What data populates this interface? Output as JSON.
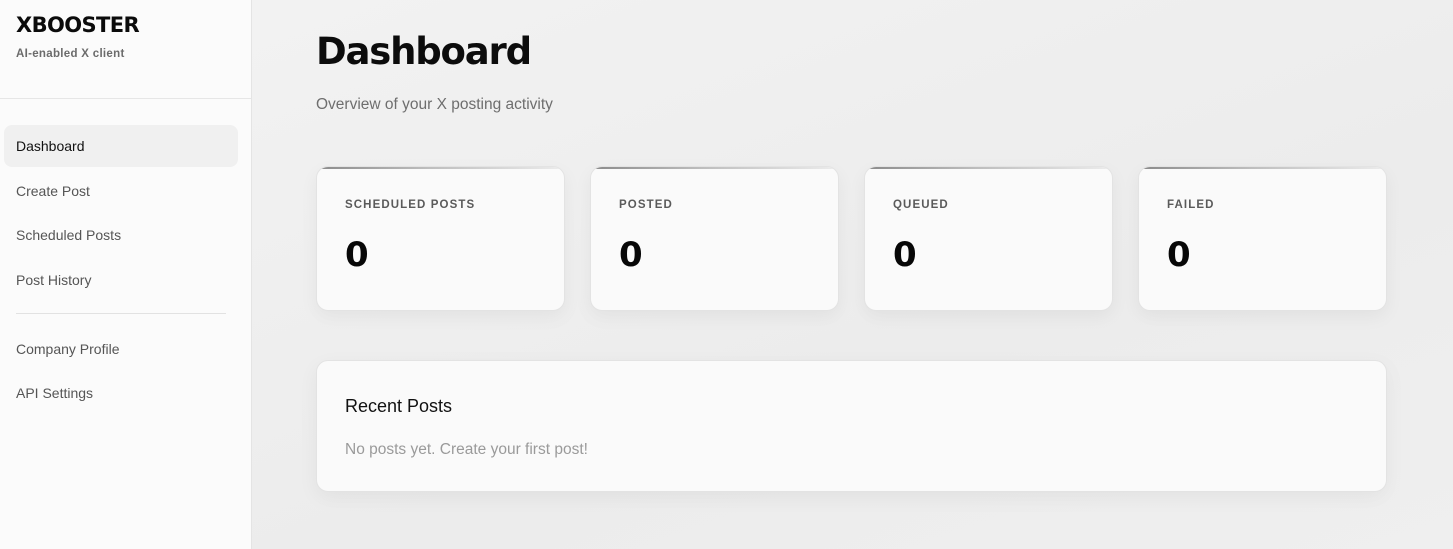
{
  "brand": {
    "title": "XBOOSTER",
    "subtitle": "AI-enabled X client"
  },
  "sidebar": {
    "items": [
      {
        "label": "Dashboard",
        "active": true
      },
      {
        "label": "Create Post"
      },
      {
        "label": "Scheduled Posts"
      },
      {
        "label": "Post History"
      }
    ],
    "secondary_items": [
      {
        "label": "Company Profile"
      },
      {
        "label": "API Settings"
      }
    ]
  },
  "main": {
    "title": "Dashboard",
    "subtitle": "Overview of your X posting activity",
    "stats": [
      {
        "label": "SCHEDULED POSTS",
        "value": "0"
      },
      {
        "label": "POSTED",
        "value": "0"
      },
      {
        "label": "QUEUED",
        "value": "0"
      },
      {
        "label": "FAILED",
        "value": "0"
      }
    ],
    "recent_posts": {
      "title": "Recent Posts",
      "empty_message": "No posts yet. Create your first post!"
    }
  }
}
